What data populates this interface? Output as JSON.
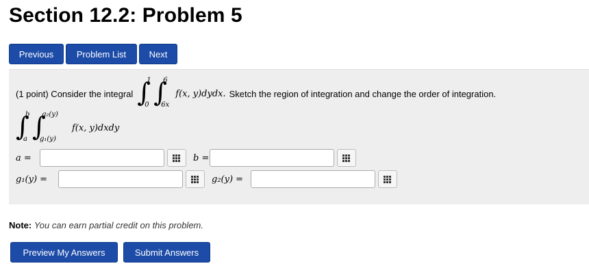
{
  "page": {
    "title": "Section 12.2: Problem 5"
  },
  "nav": {
    "previous": "Previous",
    "problem_list": "Problem List",
    "next": "Next"
  },
  "problem": {
    "points": "(1 point) Consider the integral",
    "integral1": {
      "outer_upper": "1",
      "outer_lower": "0",
      "inner_upper": "6",
      "inner_lower": "6x",
      "integrand": "f(x, y)dydx."
    },
    "instruction": "Sketch the region of integration and change the order of integration.",
    "integral2": {
      "outer_upper": "b",
      "outer_lower": "a",
      "inner_upper": "g₂(y)",
      "inner_lower": "g₁(y)",
      "integrand": "f(x, y)dxdy"
    },
    "fields": {
      "a_label": "a =",
      "b_label": "b =",
      "g1_label": "g₁(y) =",
      "g2_label": "g₂(y) =",
      "a_value": "",
      "b_value": "",
      "g1_value": "",
      "g2_value": ""
    },
    "icon": "equation-editor-icon"
  },
  "note": {
    "label": "Note:",
    "text": "You can earn partial credit on this problem."
  },
  "actions": {
    "preview": "Preview My Answers",
    "submit": "Submit Answers"
  },
  "colors": {
    "button_bg": "#1c4ba8",
    "panel_bg": "#eeeeee"
  }
}
